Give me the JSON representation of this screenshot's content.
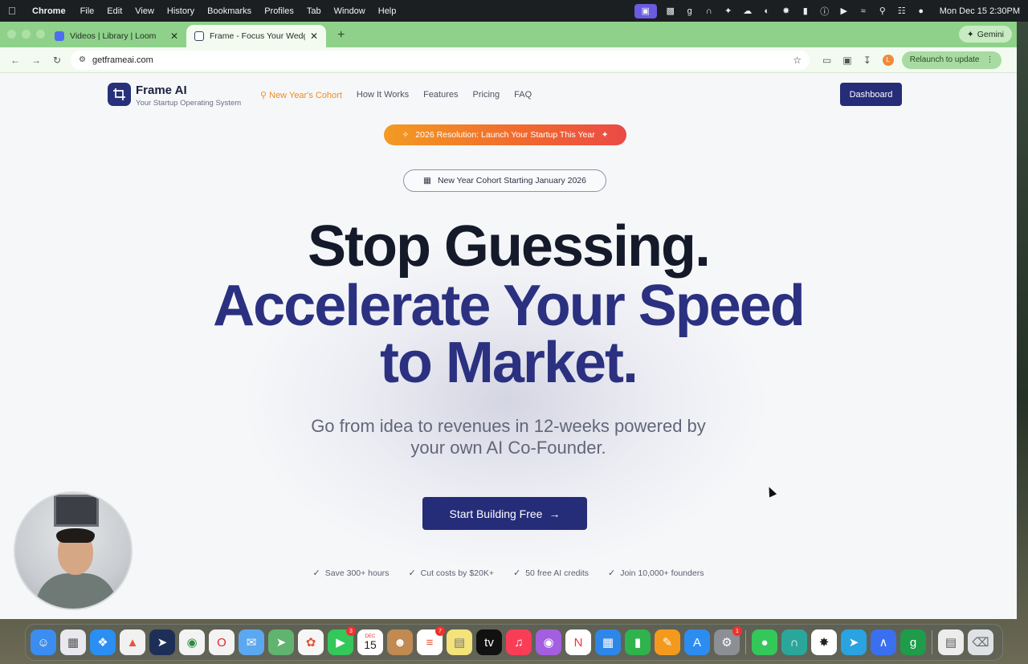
{
  "menubar": {
    "app": "Chrome",
    "items": [
      "File",
      "Edit",
      "View",
      "History",
      "Bookmarks",
      "Profiles",
      "Tab",
      "Window",
      "Help"
    ],
    "clock": "Mon Dec 15  2:30PM"
  },
  "browser": {
    "tabs": [
      {
        "title": "Videos | Library | Loom",
        "active": false
      },
      {
        "title": "Frame - Focus Your Wedge, B",
        "active": true
      }
    ],
    "gemini_label": "Gemini",
    "url": "getframeai.com",
    "profile_initial": "L",
    "relaunch_label": "Relaunch to update"
  },
  "site": {
    "brand_name": "Frame AI",
    "brand_tagline": "Your Startup Operating System",
    "nav": [
      "New Year's Cohort",
      "How It Works",
      "Features",
      "Pricing",
      "FAQ"
    ],
    "dashboard_label": "Dashboard",
    "promo_banner": "2026 Resolution: Launch Your Startup This Year",
    "cohort_pill": "New Year Cohort Starting January 2026",
    "headline_1": "Stop Guessing.",
    "headline_2": "Accelerate Your Speed",
    "headline_3": "to Market.",
    "subheadline_1": "Go from idea to revenues in 12-weeks powered by",
    "subheadline_2": "your own AI Co-Founder.",
    "cta_label": "Start Building Free",
    "benefits": [
      "Save 300+ hours",
      "Cut costs by $20K+",
      "50 free AI credits",
      "Join 10,000+ founders"
    ]
  },
  "dock": {
    "calendar_month": "DEC",
    "calendar_day": "15",
    "facetime_badge": "3",
    "reminders_badge": "7",
    "settings_badge": "1"
  },
  "colors": {
    "brand_navy": "#252c78",
    "headline_blue": "#2b3180",
    "promo_orange": "#f0672f",
    "tab_bar_green": "#8fd18a"
  }
}
